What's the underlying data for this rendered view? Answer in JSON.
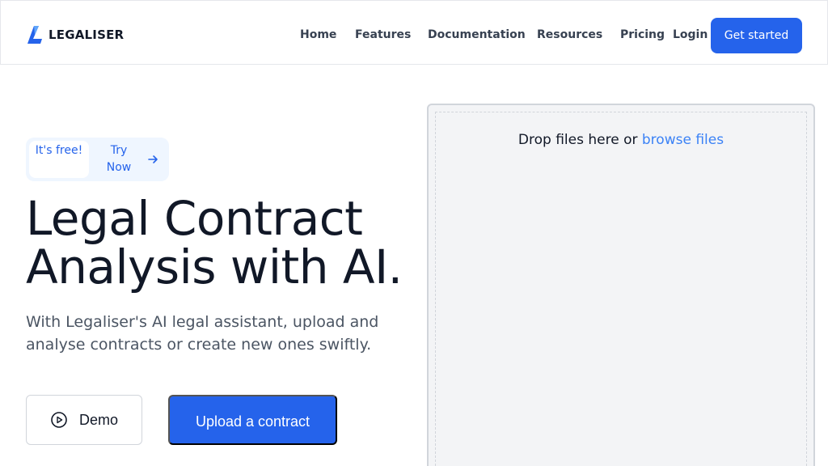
{
  "brand": {
    "name": "LEGALISER",
    "accent": "#2563eb"
  },
  "nav": {
    "links": [
      "Home",
      "Features",
      "Documentation",
      "Resources",
      "Pricing",
      "Login"
    ],
    "cta": "Get started"
  },
  "hero": {
    "pill_free": "It's free!",
    "pill_try": "Try Now",
    "title": "Legal Contract Analysis with AI.",
    "subtitle": "With Legaliser's AI legal assistant, upload and analyse contracts or create new ones swiftly.",
    "demo_button": "Demo",
    "upload_button": "Upload a contract"
  },
  "dropzone": {
    "text": "Drop files here or",
    "link": "browse files"
  },
  "icons": [
    "logo-icon",
    "arrow-right-icon",
    "play-circle-icon"
  ]
}
